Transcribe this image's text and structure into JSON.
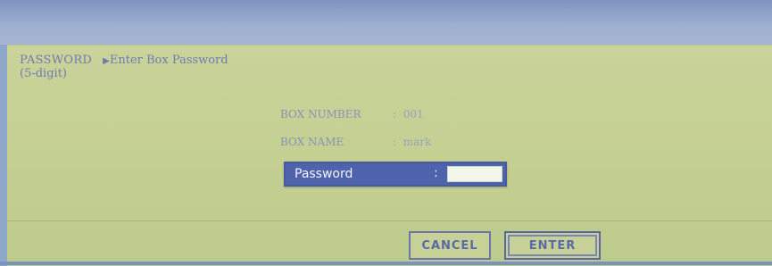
{
  "header": {
    "section": "PASSWORD",
    "arrow": "▶",
    "instruction": "Enter Box Password",
    "hint": "(5-digit)"
  },
  "box_info": {
    "number_label": "BOX NUMBER",
    "number_sep": ":",
    "number_value": "001",
    "name_label": "BOX NAME",
    "name_sep": ":",
    "name_value": "mark"
  },
  "password_field": {
    "label": "Password",
    "separator": ":",
    "value": ""
  },
  "buttons": {
    "cancel_label": "CANCEL",
    "enter_label": "ENTER"
  },
  "colors": {
    "screen_bg": "#c5d093",
    "field_bg": "#4f63ad",
    "text_accent": "#6f7cb0"
  }
}
